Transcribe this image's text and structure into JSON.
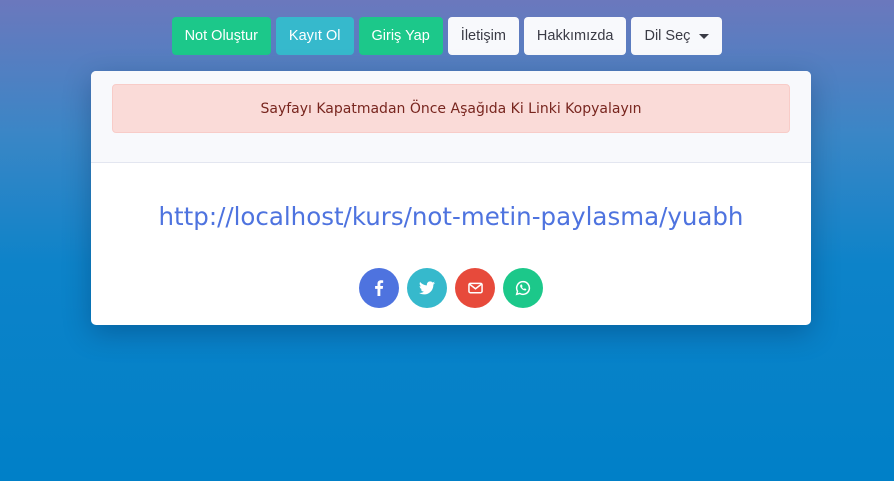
{
  "nav": {
    "not_olustur": "Not Oluştur",
    "kayit_ol": "Kayıt Ol",
    "giris_yap": "Giriş Yap",
    "iletisim": "İletişim",
    "hakkimizda": "Hakkımızda",
    "dil_sec": "Dil Seç"
  },
  "card": {
    "alert_text": "Sayfayı Kapatmadan Önce Aşağıda Ki Linki Kopyalayın",
    "link_text": "http://localhost/kurs/not-metin-paylasma/yuabh",
    "share_icons": [
      "facebook-icon",
      "twitter-icon",
      "envelope-icon",
      "whatsapp-icon"
    ]
  },
  "colors": {
    "green": "#1cc88a",
    "cyan": "#36b9cc",
    "blue": "#4e73df",
    "red": "#e74a3b",
    "light": "#f8f9fc"
  }
}
